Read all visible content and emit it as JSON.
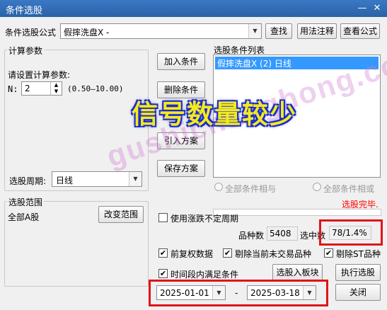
{
  "window": {
    "title": "条件选股",
    "min_icon": "minimize-icon",
    "close_icon": "close-icon"
  },
  "formula": {
    "label": "条件选股公式",
    "value": "假摔洗盘X  -",
    "search_button": "查找",
    "usage_button": "用法注释",
    "view_button": "查看公式"
  },
  "params": {
    "group_title": "计算参数",
    "prompt": "请设置计算参数:",
    "n_label": "N:",
    "n_value": "2",
    "range": "(0.50—10.00)"
  },
  "period": {
    "label": "选股周期:",
    "value": "日线"
  },
  "actions": {
    "add_condition": "加入条件",
    "delete_condition": "删除条件",
    "import_scheme": "引入方案",
    "save_scheme": "保存方案"
  },
  "condition_list": {
    "title": "选股条件列表",
    "items": [
      "假摔洗盘X (2) 日线"
    ]
  },
  "logic": {
    "and_label": "全部条件相与",
    "or_label": "全部条件相或"
  },
  "scope": {
    "group_title": "选股范围",
    "value": "全部A股",
    "change_button": "改变范围"
  },
  "status": {
    "done_text": "选股完毕."
  },
  "use_volatile_period": {
    "label": "使用涨跌不定周期",
    "checked": false
  },
  "results": {
    "count_label": "品种数",
    "count_value": "5408",
    "selected_label": "选中数",
    "selected_value": "78/1.4%"
  },
  "options": {
    "forward_adjust": {
      "label": "前复权数据",
      "checked": true
    },
    "exclude_untraded": {
      "label": "剔除当前未交易品种",
      "checked": true
    },
    "exclude_st": {
      "label": "剔除ST品种",
      "checked": true
    },
    "time_range": {
      "label": "时间段内满足条件",
      "checked": true
    }
  },
  "buttons": {
    "to_sector": "选股入板块",
    "run": "执行选股",
    "close": "关闭"
  },
  "dates": {
    "start": "2025-01-01",
    "separator": "-",
    "end": "2025-03-18"
  },
  "overlay": {
    "banner": "信号数量较少",
    "watermark": "gushichanghong.com"
  },
  "colors": {
    "highlight_red": "#e0141a",
    "selection_blue": "#3399ff",
    "banner_yellow": "#f4ea1c",
    "banner_outline": "#1a2ad1",
    "status_red": "#ff0000"
  }
}
